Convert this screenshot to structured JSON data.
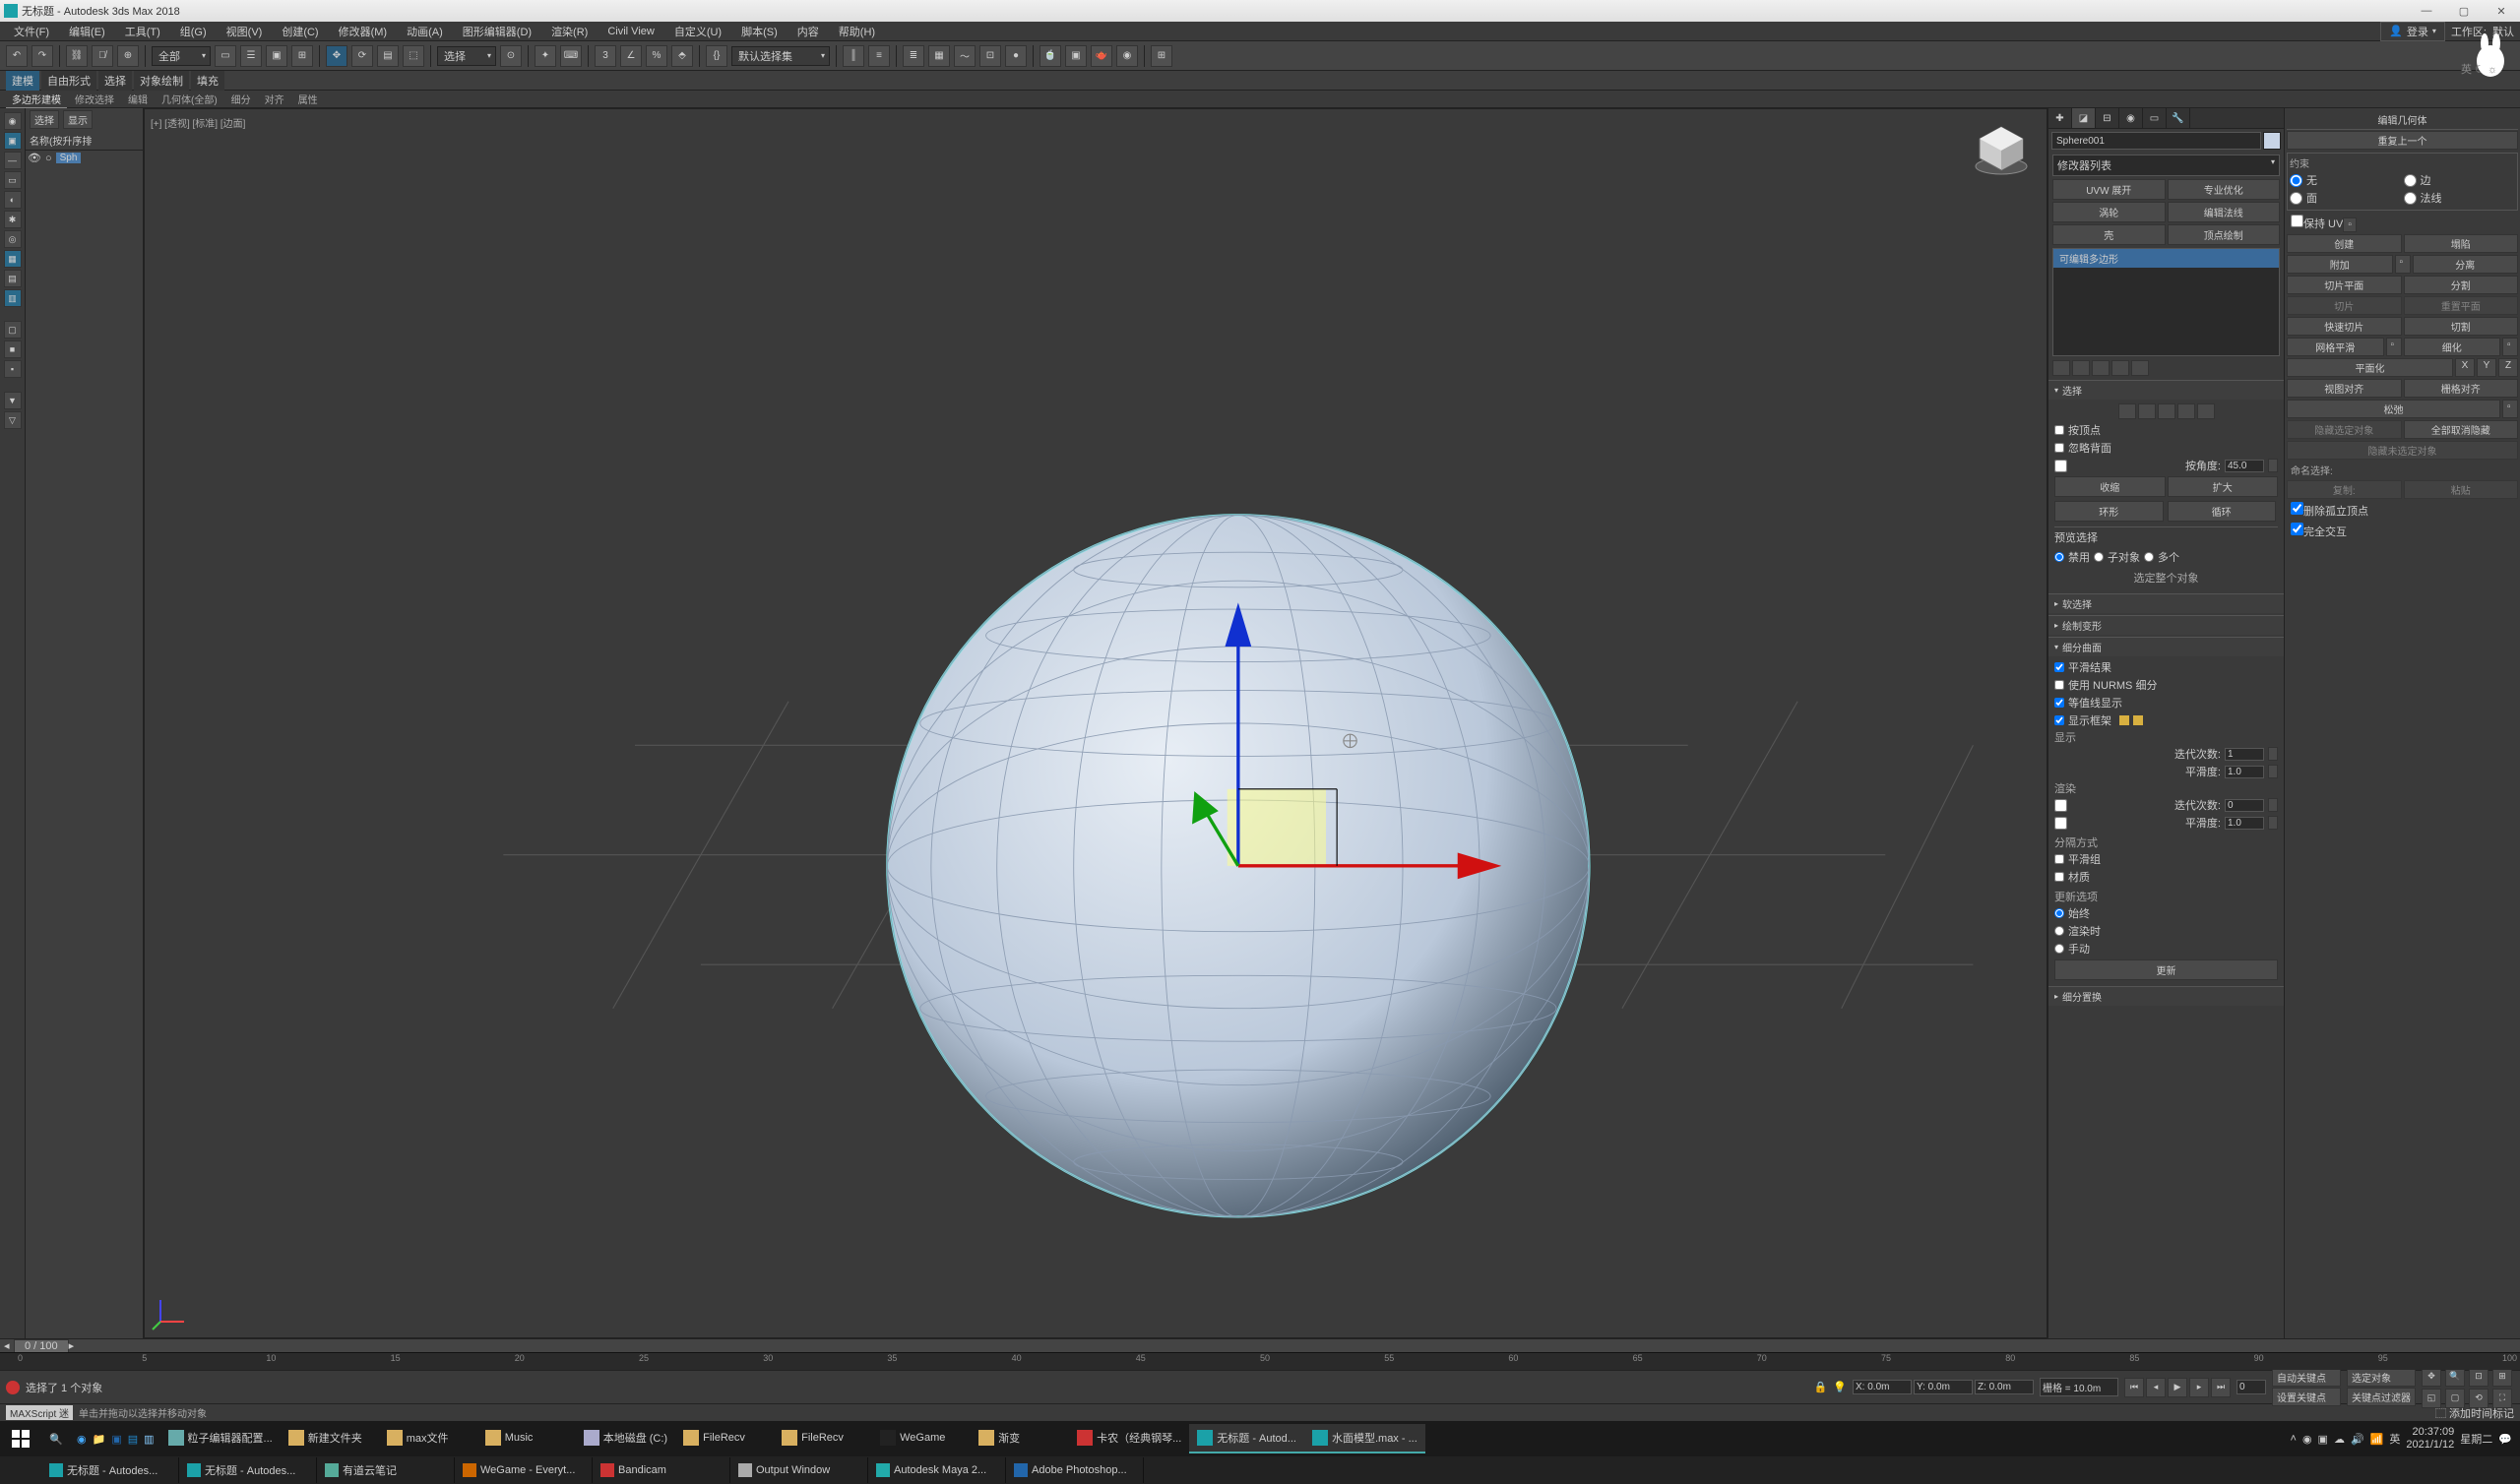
{
  "title": "无标题 - Autodesk 3ds Max 2018",
  "win": {
    "min": "—",
    "max": "▢",
    "close": "✕"
  },
  "menu": [
    "文件(F)",
    "编辑(E)",
    "工具(T)",
    "组(G)",
    "视图(V)",
    "创建(C)",
    "修改器(M)",
    "动画(A)",
    "图形编辑器(D)",
    "渲染(R)",
    "Civil View",
    "自定义(U)",
    "脚本(S)",
    "内容",
    "帮助(H)"
  ],
  "menur": {
    "login": "登录",
    "ws": "工作区:",
    "def": "默认"
  },
  "tb_dd1": "全部",
  "tb_dd2": "选择",
  "tb_dd3": "默认选择集",
  "sub1": {
    "a": "建模",
    "b": "自由形式",
    "c": "选择",
    "d": "对象绘制",
    "e": "填充"
  },
  "tabs": [
    "多边形建模",
    "修改选择",
    "编辑",
    "几何体(全部)",
    "细分",
    "对齐",
    "属性"
  ],
  "scenebtns": [
    "选择",
    "显示"
  ],
  "scenehdr": "名称(按升序排",
  "scenenode": "Sph",
  "vplabel": "[+] [透视] [标准] [边面]",
  "cmd": {
    "objname": "Sphere001",
    "modlist": "修改器列表",
    "b1": "UVW 展开",
    "b2": "专业优化",
    "b3": "涡轮",
    "b4": "编辑法线",
    "b5": "壳",
    "b6": "顶点绘制",
    "stack": "可编辑多边形",
    "r_sel": "选择",
    "sel_byv": "按顶点",
    "sel_ig": "忽略背面",
    "sel_ang": "按角度:",
    "sel_angv": "45.0",
    "sel_sh": "收缩",
    "sel_gr": "扩大",
    "sel_rg": "环形",
    "sel_lp": "循环",
    "presel": "预览选择",
    "ps_off": "禁用",
    "ps_sub": "子对象",
    "ps_mul": "多个",
    "sel_info": "选定整个对象",
    "r_soft": "软选择",
    "r_paint": "绘制变形",
    "r_subd": "细分曲面",
    "sd_smooth": "平滑结果",
    "sd_nurms": "使用 NURMS 细分",
    "sd_iso": "等值线显示",
    "sd_cage": "显示框架",
    "sd_disp": "显示",
    "sd_iter": "迭代次数:",
    "sd_iterv": "1",
    "sd_sm": "平滑度:",
    "sd_smv": "1.0",
    "sd_rend": "渲染",
    "sd_riter": "迭代次数:",
    "sd_riterv": "0",
    "sd_rsm": "平滑度:",
    "sd_rsmv": "1.0",
    "sd_sep": "分隔方式",
    "sd_sg": "平滑组",
    "sd_mat": "材质",
    "sd_upd": "更新选项",
    "sd_always": "始终",
    "sd_render": "渲染时",
    "sd_man": "手动",
    "sd_btn": "更新",
    "r_subx": "细分置换"
  },
  "rp": {
    "hdr": "编辑几何体",
    "prev": "重复上一个",
    "con": "约束",
    "c_none": "无",
    "c_edge": "边",
    "c_face": "面",
    "c_norm": "法线",
    "puv": "保持 UV",
    "create": "创建",
    "collapse": "塌陷",
    "attach": "附加",
    "detach": "分离",
    "slice_p": "切片平面",
    "split": "分割",
    "slice": "切片",
    "reset_p": "重置平面",
    "quick": "快速切片",
    "cut": "切割",
    "msm": "网格平滑",
    "tess": "细化",
    "planar": "平面化",
    "xyz_x": "X",
    "xyz_y": "Y",
    "xyz_z": "Z",
    "vw_align": "视图对齐",
    "grid_align": "栅格对齐",
    "relax": "松弛",
    "hide_sel": "隐藏选定对象",
    "unhide": "全部取消隐藏",
    "hide_un": "隐藏未选定对象",
    "named": "命名选择:",
    "copy": "复制:",
    "paste": "粘贴",
    "del_iso": "删除孤立顶点",
    "full": "完全交互"
  },
  "tl": {
    "range": "0 / 100",
    "ticks": [
      "0",
      "5",
      "10",
      "15",
      "20",
      "25",
      "30",
      "35",
      "40",
      "45",
      "50",
      "55",
      "60",
      "65",
      "70",
      "75",
      "80",
      "85",
      "90",
      "95",
      "100"
    ]
  },
  "status": {
    "sel": "选择了 1 个对象",
    "x": "X: 0.0m",
    "y": "Y: 0.0m",
    "z": "Z: 0.0m",
    "grid": "栅格 = 10.0m",
    "auto": "自动关键点",
    "selset": "选定对象",
    "key": "设置关键点",
    "filt": "关键点过滤器",
    "time": "添加时间标记"
  },
  "ms": {
    "label": "MAXScript 迷",
    "prompt": "单击并拖动以选择并移动对象"
  },
  "tb1": [
    {
      "l": "粒子编辑器配置...",
      "c": "#6aa"
    },
    {
      "l": "新建文件夹",
      "c": "#d8b060"
    },
    {
      "l": "max文件",
      "c": "#d8b060"
    },
    {
      "l": "Music",
      "c": "#d8b060"
    },
    {
      "l": "本地磁盘 (C:)",
      "c": "#aac"
    },
    {
      "l": "FileRecv",
      "c": "#d8b060"
    },
    {
      "l": "FileRecv",
      "c": "#d8b060"
    },
    {
      "l": "WeGame",
      "c": "#222"
    },
    {
      "l": "渐变",
      "c": "#d8b060"
    },
    {
      "l": "卡农（经典钢琴...",
      "c": "#c33"
    },
    {
      "l": "无标题 - Autod...",
      "c": "#1ba1a8"
    },
    {
      "l": "水面模型.max - ...",
      "c": "#1ba1a8"
    }
  ],
  "tb2": [
    {
      "l": "无标题 - Autodes...",
      "c": "#1ba1a8"
    },
    {
      "l": "无标题 - Autodes...",
      "c": "#1ba1a8"
    },
    {
      "l": "有道云笔记",
      "c": "#5a9"
    },
    {
      "l": "WeGame - Everyt...",
      "c": "#c60"
    },
    {
      "l": "Bandicam",
      "c": "#c33"
    },
    {
      "l": "Output Window",
      "c": "#aaa"
    },
    {
      "l": "Autodesk Maya 2...",
      "c": "#2aa"
    },
    {
      "l": "Adobe Photoshop...",
      "c": "#26a"
    }
  ],
  "clock": {
    "t": "20:37:09",
    "d": "2021/1/12",
    "day": "星期二",
    "ime": "英"
  }
}
